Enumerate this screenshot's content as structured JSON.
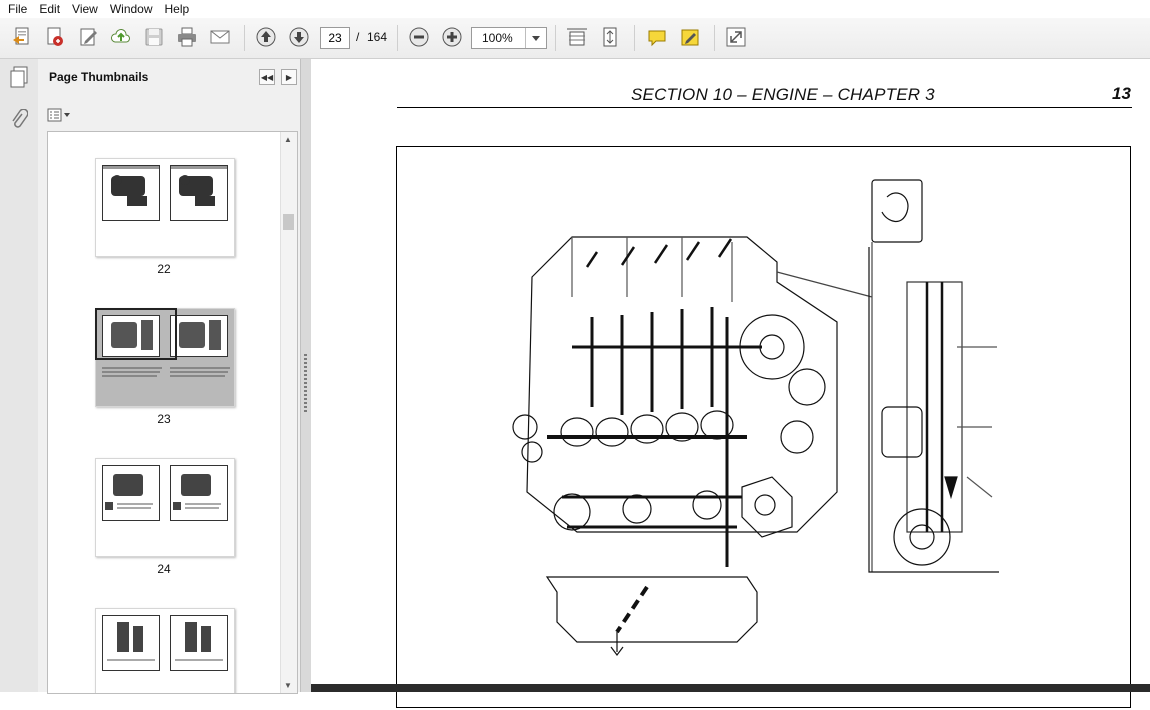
{
  "menu": [
    "File",
    "Edit",
    "View",
    "Window",
    "Help"
  ],
  "toolbar": {
    "current_page": "23",
    "page_separator": "/",
    "total_pages": "164",
    "zoom": "100%"
  },
  "panel": {
    "title": "Page Thumbnails",
    "thumbnails": [
      {
        "label": "22",
        "selected": false
      },
      {
        "label": "23",
        "selected": true
      },
      {
        "label": "24",
        "selected": false
      },
      {
        "label": "",
        "selected": false
      }
    ]
  },
  "document": {
    "heading": "SECTION 10 – ENGINE – CHAPTER 3",
    "page_number": "13"
  },
  "icons": {
    "create": "create-pdf-icon",
    "edit": "edit-pdf-icon",
    "upload": "cloud-upload-icon",
    "save": "save-icon",
    "print": "print-icon",
    "email": "email-icon",
    "prev": "arrow-up-icon",
    "next": "arrow-down-icon",
    "zoom_out": "minus-icon",
    "zoom_in": "plus-icon",
    "fit_width": "fit-width-icon",
    "fit_page": "fit-page-icon",
    "comment": "comment-icon",
    "highlight": "highlight-icon",
    "fullscreen": "expand-icon"
  },
  "colors": {
    "accent": "#2a6fb5",
    "selection": "#b9b9b9"
  }
}
